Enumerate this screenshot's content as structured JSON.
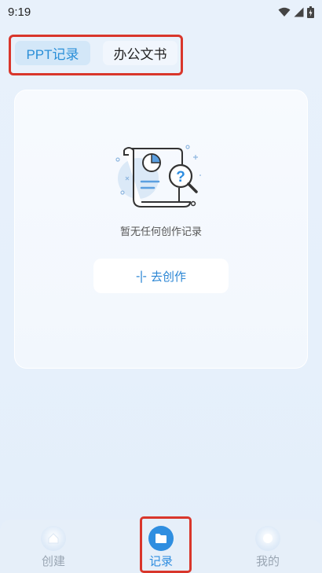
{
  "status_bar": {
    "time": "9:19",
    "icons": [
      "wifi-icon",
      "signal-icon",
      "battery-icon"
    ]
  },
  "tabs": [
    {
      "label": "PPT记录",
      "selected": true
    },
    {
      "label": "办公文书",
      "selected": false
    }
  ],
  "empty_state": {
    "illustration": "document-search-icon",
    "message": "暂无任何创作记录",
    "button_label": "去创作",
    "button_icon": "plus-icon"
  },
  "bottom_nav": {
    "items": [
      {
        "label": "创建",
        "icon": "home-icon",
        "active": false
      },
      {
        "label": "记录",
        "icon": "folder-icon",
        "active": true
      },
      {
        "label": "我的",
        "icon": "user-icon",
        "active": false
      }
    ]
  },
  "colors": {
    "accent": "#2f8ee0",
    "highlight_frame": "#d9362b",
    "background": "#e6f0fb"
  }
}
